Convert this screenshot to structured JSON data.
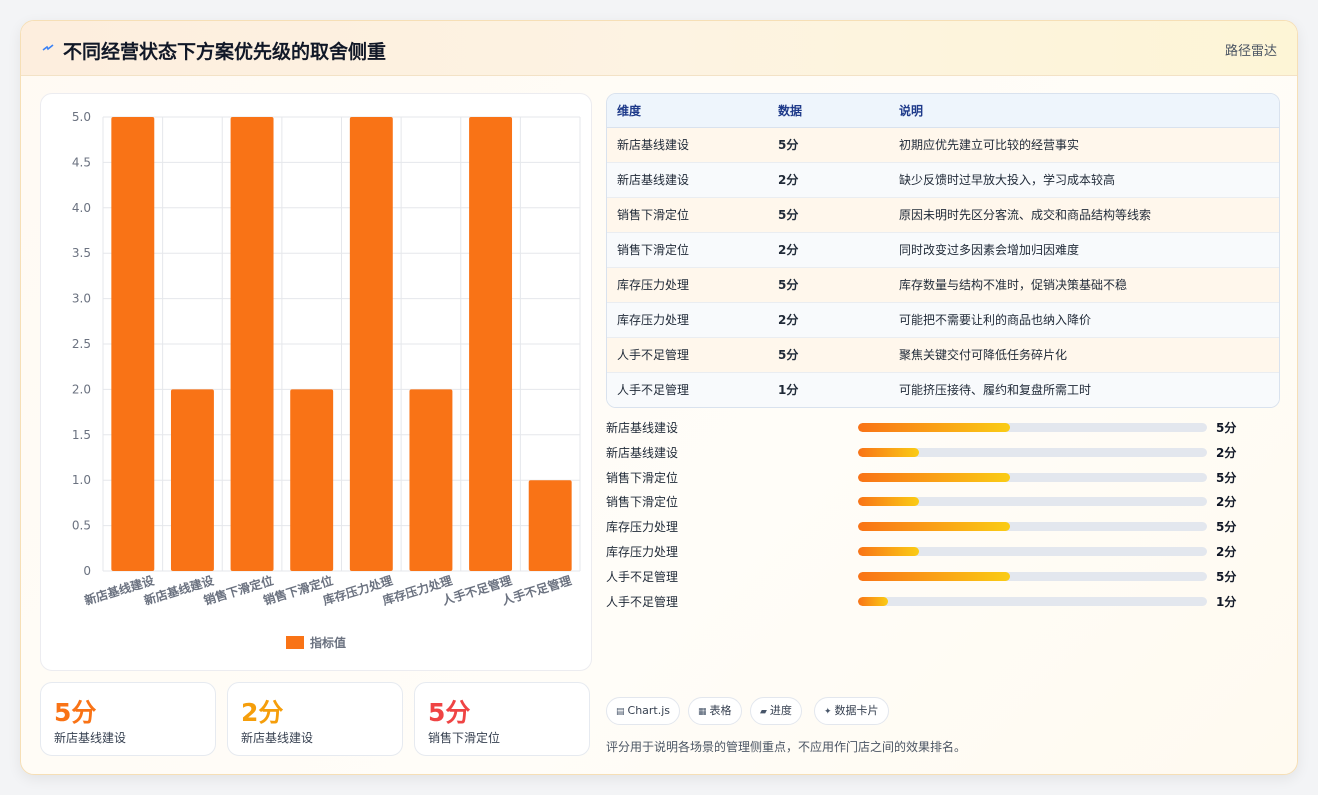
{
  "header": {
    "title": "不同经营状态下方案优先级的取舍侧重",
    "tag": "路径雷达"
  },
  "colors": {
    "bar": "#f97316",
    "accent_orange": "#f97316",
    "accent_amber": "#f59e0b",
    "accent_red": "#ef4444",
    "grid": "#e5e7eb",
    "tick_text": "#6b7280"
  },
  "chart_data": {
    "type": "bar",
    "categories": [
      "新店基线建设",
      "新店基线建设",
      "销售下滑定位",
      "销售下滑定位",
      "库存压力处理",
      "库存压力处理",
      "人手不足管理",
      "人手不足管理"
    ],
    "series": [
      {
        "name": "指标值",
        "values": [
          5,
          2,
          5,
          2,
          5,
          2,
          5,
          1
        ]
      }
    ],
    "ylim": [
      0,
      5
    ],
    "yticks": [
      "0",
      "0.5",
      "1.0",
      "1.5",
      "2.0",
      "2.5",
      "3.0",
      "3.5",
      "4.0",
      "4.5",
      "5.0"
    ],
    "grid": true,
    "legend": "bottom",
    "title": "",
    "xlabel": "",
    "ylabel": ""
  },
  "kpis": [
    {
      "value": "5分",
      "label": "新店基线建设",
      "color": "#f97316"
    },
    {
      "value": "2分",
      "label": "新店基线建设",
      "color": "#f59e0b"
    },
    {
      "value": "5分",
      "label": "销售下滑定位",
      "color": "#ef4444"
    }
  ],
  "table": {
    "headers": [
      "维度",
      "数据",
      "说明"
    ],
    "rows": [
      [
        "新店基线建设",
        "5分",
        "初期应优先建立可比较的经营事实"
      ],
      [
        "新店基线建设",
        "2分",
        "缺少反馈时过早放大投入，学习成本较高"
      ],
      [
        "销售下滑定位",
        "5分",
        "原因未明时先区分客流、成交和商品结构等线索"
      ],
      [
        "销售下滑定位",
        "2分",
        "同时改变过多因素会增加归因难度"
      ],
      [
        "库存压力处理",
        "5分",
        "库存数量与结构不准时，促销决策基础不稳"
      ],
      [
        "库存压力处理",
        "2分",
        "可能把不需要让利的商品也纳入降价"
      ],
      [
        "人手不足管理",
        "5分",
        "聚焦关键交付可降低任务碎片化"
      ],
      [
        "人手不足管理",
        "1分",
        "可能挤压接待、履约和复盘所需工时"
      ]
    ]
  },
  "progress": {
    "max": 5,
    "items": [
      {
        "label": "新店基线建设",
        "value": 5,
        "text": "5分"
      },
      {
        "label": "新店基线建设",
        "value": 2,
        "text": "2分"
      },
      {
        "label": "销售下滑定位",
        "value": 5,
        "text": "5分"
      },
      {
        "label": "销售下滑定位",
        "value": 2,
        "text": "2分"
      },
      {
        "label": "库存压力处理",
        "value": 5,
        "text": "5分"
      },
      {
        "label": "库存压力处理",
        "value": 2,
        "text": "2分"
      },
      {
        "label": "人手不足管理",
        "value": 5,
        "text": "5分"
      },
      {
        "label": "人手不足管理",
        "value": 1,
        "text": "1分"
      }
    ]
  },
  "chips": [
    {
      "icon": "chart-icon",
      "label": "Chart.js"
    },
    {
      "icon": "table-icon",
      "label": "表格"
    },
    {
      "icon": "progress-icon",
      "label": "进度"
    },
    {
      "icon": "sparkle-icon",
      "label": "数据卡片"
    }
  ],
  "footnote": "评分用于说明各场景的管理侧重点，不应用作门店之间的效果排名。"
}
